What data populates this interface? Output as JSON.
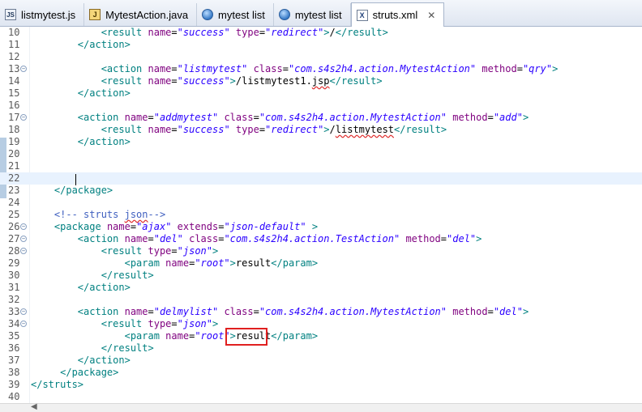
{
  "tabs": [
    {
      "label": "listmytest.js",
      "icon": "js-file-icon"
    },
    {
      "label": "MytestAction.java",
      "icon": "java-file-icon"
    },
    {
      "label": "mytest list",
      "icon": "globe-icon"
    },
    {
      "label": "mytest list",
      "icon": "globe-icon"
    },
    {
      "label": "struts.xml",
      "icon": "xml-file-icon",
      "active": true,
      "close": "✕"
    }
  ],
  "lines": [
    {
      "n": "10",
      "html": "            <span class='t'>&lt;result </span><span class='a'>name</span>=<span class='v'>\"success\"</span> <span class='a'>type</span>=<span class='v'>\"redirect\"</span><span class='t'>&gt;</span><span class='txt'>/</span><span class='t'>&lt;/result&gt;</span>"
    },
    {
      "n": "11",
      "html": "        <span class='t'>&lt;/action&gt;</span>"
    },
    {
      "n": "12",
      "html": ""
    },
    {
      "n": "13",
      "fold": true,
      "html": "            <span class='t'>&lt;action </span><span class='a'>name</span>=<span class='v'>\"listmytest\"</span> <span class='a'>class</span>=<span class='v'>\"com.s4s2h4.action.MytestAction\"</span> <span class='a'>method</span>=<span class='v'>\"qry\"</span><span class='t'>&gt;</span>"
    },
    {
      "n": "14",
      "html": "            <span class='t'>&lt;result </span><span class='a'>name</span>=<span class='v'>\"success\"</span><span class='t'>&gt;</span><span class='txt'>/listmytest1.<span class='sq'>jsp</span></span><span class='t'>&lt;/result&gt;</span>"
    },
    {
      "n": "15",
      "html": "        <span class='t'>&lt;/action&gt;</span>"
    },
    {
      "n": "16",
      "html": ""
    },
    {
      "n": "17",
      "fold": true,
      "html": "        <span class='t'>&lt;action </span><span class='a'>name</span>=<span class='v'>\"addmytest\"</span> <span class='a'>class</span>=<span class='v'>\"com.s4s2h4.action.MytestAction\"</span> <span class='a'>method</span>=<span class='v'>\"add\"</span><span class='t'>&gt;</span>"
    },
    {
      "n": "18",
      "html": "            <span class='t'>&lt;result </span><span class='a'>name</span>=<span class='v'>\"success\"</span> <span class='a'>type</span>=<span class='v'>\"redirect\"</span><span class='t'>&gt;</span><span class='txt'>/<span class='sq'>listmytest</span></span><span class='t'>&lt;/result&gt;</span>"
    },
    {
      "n": "19",
      "html": "        <span class='t'>&lt;/action&gt;</span>"
    },
    {
      "n": "20",
      "html": ""
    },
    {
      "n": "21",
      "html": ""
    },
    {
      "n": "22",
      "current": true,
      "html": ""
    },
    {
      "n": "23",
      "html": "    <span class='t'>&lt;/package&gt;</span>"
    },
    {
      "n": "24",
      "html": ""
    },
    {
      "n": "25",
      "html": "    <span class='c'>&lt;!-- struts <span class='sq'>json</span>--&gt;</span>"
    },
    {
      "n": "26",
      "fold": true,
      "html": "    <span class='t'>&lt;package </span><span class='a'>name</span>=<span class='v'>\"ajax\"</span> <span class='a'>extends</span>=<span class='v'>\"json-default\"</span> <span class='t'>&gt;</span>"
    },
    {
      "n": "27",
      "fold": true,
      "html": "        <span class='t'>&lt;action </span><span class='a'>name</span>=<span class='v'>\"del\"</span> <span class='a'>class</span>=<span class='v'>\"com.s4s2h4.action.TestAction\"</span> <span class='a'>method</span>=<span class='v'>\"del\"</span><span class='t'>&gt;</span>"
    },
    {
      "n": "28",
      "fold": true,
      "html": "            <span class='t'>&lt;result </span><span class='a'>type</span>=<span class='v'>\"json\"</span><span class='t'>&gt;</span>"
    },
    {
      "n": "29",
      "html": "                <span class='t'>&lt;param </span><span class='a'>name</span>=<span class='v'>\"root\"</span><span class='t'>&gt;</span><span class='txt'>result</span><span class='t'>&lt;/param&gt;</span>"
    },
    {
      "n": "30",
      "html": "            <span class='t'>&lt;/result&gt;</span>"
    },
    {
      "n": "31",
      "html": "        <span class='t'>&lt;/action&gt;</span>"
    },
    {
      "n": "32",
      "html": ""
    },
    {
      "n": "33",
      "fold": true,
      "html": "        <span class='t'>&lt;action </span><span class='a'>name</span>=<span class='v'>\"delmylist\"</span> <span class='a'>class</span>=<span class='v'>\"com.s4s2h4.action.MytestAction\"</span> <span class='a'>method</span>=<span class='v'>\"del\"</span><span class='t'>&gt;</span>"
    },
    {
      "n": "34",
      "fold": true,
      "html": "            <span class='t'>&lt;result </span><span class='a'>type</span>=<span class='v'>\"json\"</span><span class='t'>&gt;</span>"
    },
    {
      "n": "35",
      "html": "                <span class='t'>&lt;param </span><span class='a'>name</span>=<span class='v'>\"root\"</span><span class='t'>&gt;</span><span class='txt'>result</span><span class='t'>&lt;/param&gt;</span>"
    },
    {
      "n": "36",
      "html": "            <span class='t'>&lt;/result&gt;</span>"
    },
    {
      "n": "37",
      "html": "        <span class='t'>&lt;/action&gt;</span>"
    },
    {
      "n": "38",
      "html": "     <span class='t'>&lt;/package&gt;</span>"
    },
    {
      "n": "39",
      "html": "<span class='t'>&lt;/struts&gt;</span>"
    },
    {
      "n": "40",
      "html": ""
    }
  ],
  "scroll_left_arrow": "◀"
}
